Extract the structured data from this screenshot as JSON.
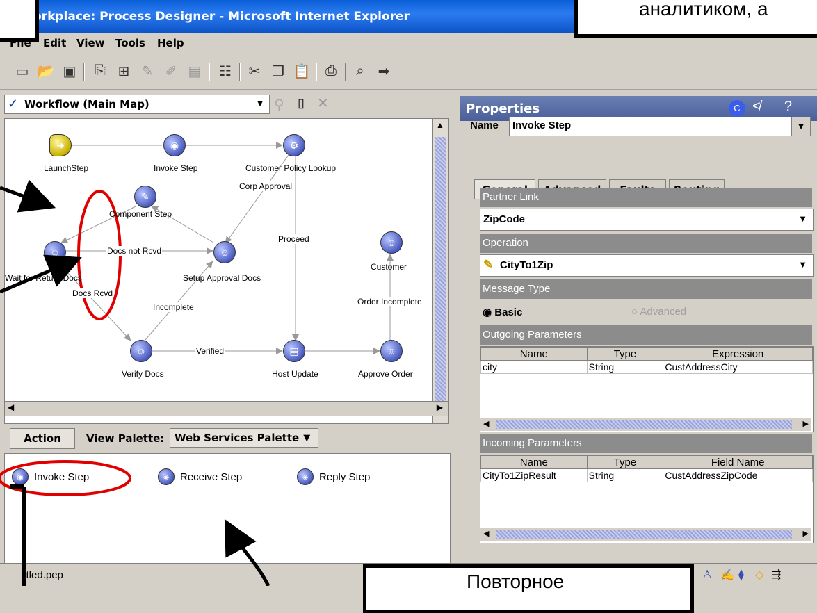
{
  "window": {
    "title": "orkplace: Process Designer - Microsoft Internet Explorer"
  },
  "menu": {
    "items": [
      "File",
      "Edit",
      "View",
      "Tools",
      "Help"
    ]
  },
  "map": {
    "selector": "Workflow (Main Map)",
    "nodes": {
      "launch": "LaunchStep",
      "invoke": "Invoke Step",
      "policy": "Customer Policy Lookup",
      "component": "Component Step",
      "wait_return": "Wait for Return Docs",
      "setup": "Setup Approval Docs",
      "customer": "Customer",
      "verify": "Verify Docs",
      "host": "Host Update",
      "approve": "Approve Order"
    },
    "edges": {
      "corp": "Corp Approval",
      "docs_not": "Docs not Rcvd",
      "proceed": "Proceed",
      "docs_rcvd": "Docs Rcvd",
      "incomplete": "Incomplete",
      "order_incomplete": "Order Incomplete",
      "verified": "Verified"
    }
  },
  "palette": {
    "action": "Action",
    "view_label": "View Palette:",
    "selected": "Web Services Palette",
    "items": [
      "Invoke Step",
      "Receive Step",
      "Reply Step"
    ]
  },
  "status": {
    "file": "titled.pep"
  },
  "properties": {
    "header": "Properties",
    "name_label": "Name",
    "name_value": "Invoke Step",
    "tabs": [
      "General",
      "Advanced",
      "Faults",
      "Routing"
    ],
    "partner_link_label": "Partner Link",
    "partner_link_value": "ZipCode",
    "operation_label": "Operation",
    "operation_value": "CityTo1Zip",
    "message_type_label": "Message Type",
    "basic": "Basic",
    "advanced": "Advanced",
    "outgoing_label": "Outgoing Parameters",
    "outgoing_cols": [
      "Name",
      "Type",
      "Expression"
    ],
    "outgoing_rows": [
      [
        "city",
        "String",
        "CustAddressCity"
      ]
    ],
    "incoming_label": "Incoming Parameters",
    "incoming_cols": [
      "Name",
      "Type",
      "Field Name"
    ],
    "incoming_rows": [
      [
        "CityTo1ZipResult",
        "String",
        "CustAddressZipCode"
      ]
    ]
  },
  "callouts": {
    "top_right": "аналитиком, а",
    "bottom": "Повторное"
  },
  "colors": {
    "titlebar": "#0a5fd8",
    "highlight_circle": "#e00000",
    "panel": "#d4d0c8"
  }
}
